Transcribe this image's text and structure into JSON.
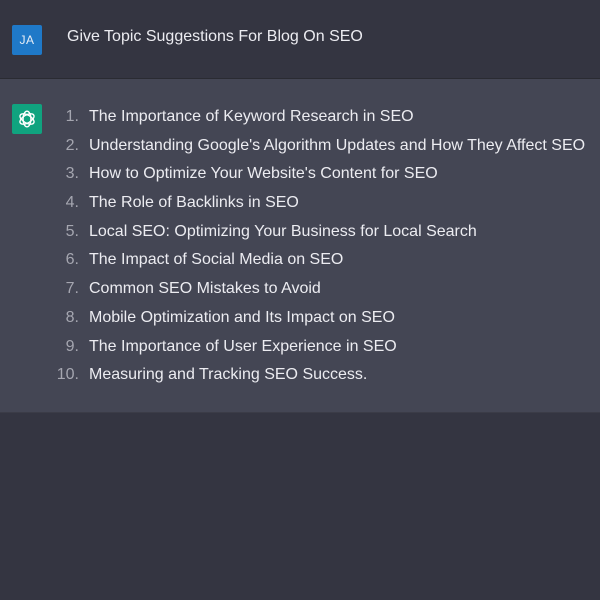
{
  "conversation": {
    "user": {
      "avatar_initials": "JA",
      "message": "Give Topic Suggestions For Blog On SEO"
    },
    "assistant": {
      "avatar_icon": "openai-logo-icon",
      "items": [
        {
          "num": "1.",
          "text": "The Importance of Keyword Research in SEO"
        },
        {
          "num": "2.",
          "text": "Understanding Google's Algorithm Updates and How They Affect SEO"
        },
        {
          "num": "3.",
          "text": "How to Optimize Your Website's Content for SEO"
        },
        {
          "num": "4.",
          "text": "The Role of Backlinks in SEO"
        },
        {
          "num": "5.",
          "text": "Local SEO: Optimizing Your Business for Local Search"
        },
        {
          "num": "6.",
          "text": "The Impact of Social Media on SEO"
        },
        {
          "num": "7.",
          "text": "Common SEO Mistakes to Avoid"
        },
        {
          "num": "8.",
          "text": "Mobile Optimization and Its Impact on SEO"
        },
        {
          "num": "9.",
          "text": "The Importance of User Experience in SEO"
        },
        {
          "num": "10.",
          "text": "Measuring and Tracking SEO Success."
        }
      ]
    }
  },
  "colors": {
    "page_background": "#343541",
    "assistant_background": "#444654",
    "user_avatar": "#1f79c8",
    "assistant_avatar": "#10a37f",
    "text": "#ececf1",
    "muted_text": "#a5a6b0"
  }
}
